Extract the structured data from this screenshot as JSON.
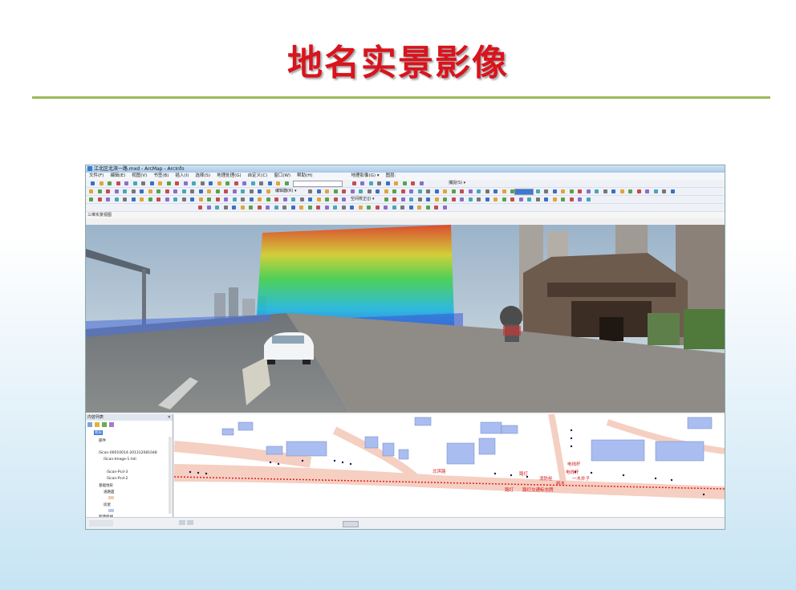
{
  "slide": {
    "title": "地名实景影像"
  },
  "app": {
    "window_title": "江北区北滨一路.mxd - ArcMap - ArcInfo",
    "menu": [
      "文件(F)",
      "编辑(E)",
      "视图(V)",
      "书签(B)",
      "插入(I)",
      "选择(S)",
      "地理处理(G)",
      "自定义(C)",
      "窗口(W)",
      "帮助(H)"
    ],
    "toolbar_labels": {
      "geo_image": "地理影像(G) ▾",
      "layer": "图层:",
      "edit": "编辑器(R) ▾",
      "capture": "捕捉(S) ▾",
      "spatial": "空间校正(J) ▾"
    },
    "view_label": "三维实景视图"
  },
  "toc": {
    "title": "内容列表",
    "items": [
      "图层",
      "部件",
      "iScan-00010014-201312081048",
      "iScan-Image-1.hdi",
      "iScan-Pcd-3",
      "iScan-Pcd-2",
      "基础地形",
      "道路面",
      "房屋",
      "新建折线"
    ]
  },
  "map": {
    "labels": [
      "北滨路",
      "路灯",
      "消防栓",
      "电线杆",
      "路灯",
      "路灯交通标志牌",
      "树木",
      "电线杆",
      "一木井子"
    ]
  },
  "colors": {
    "title": "#d8141d",
    "rule": "#9bbb59",
    "road": "#f5cfc2",
    "building": "#a9bdf0"
  }
}
